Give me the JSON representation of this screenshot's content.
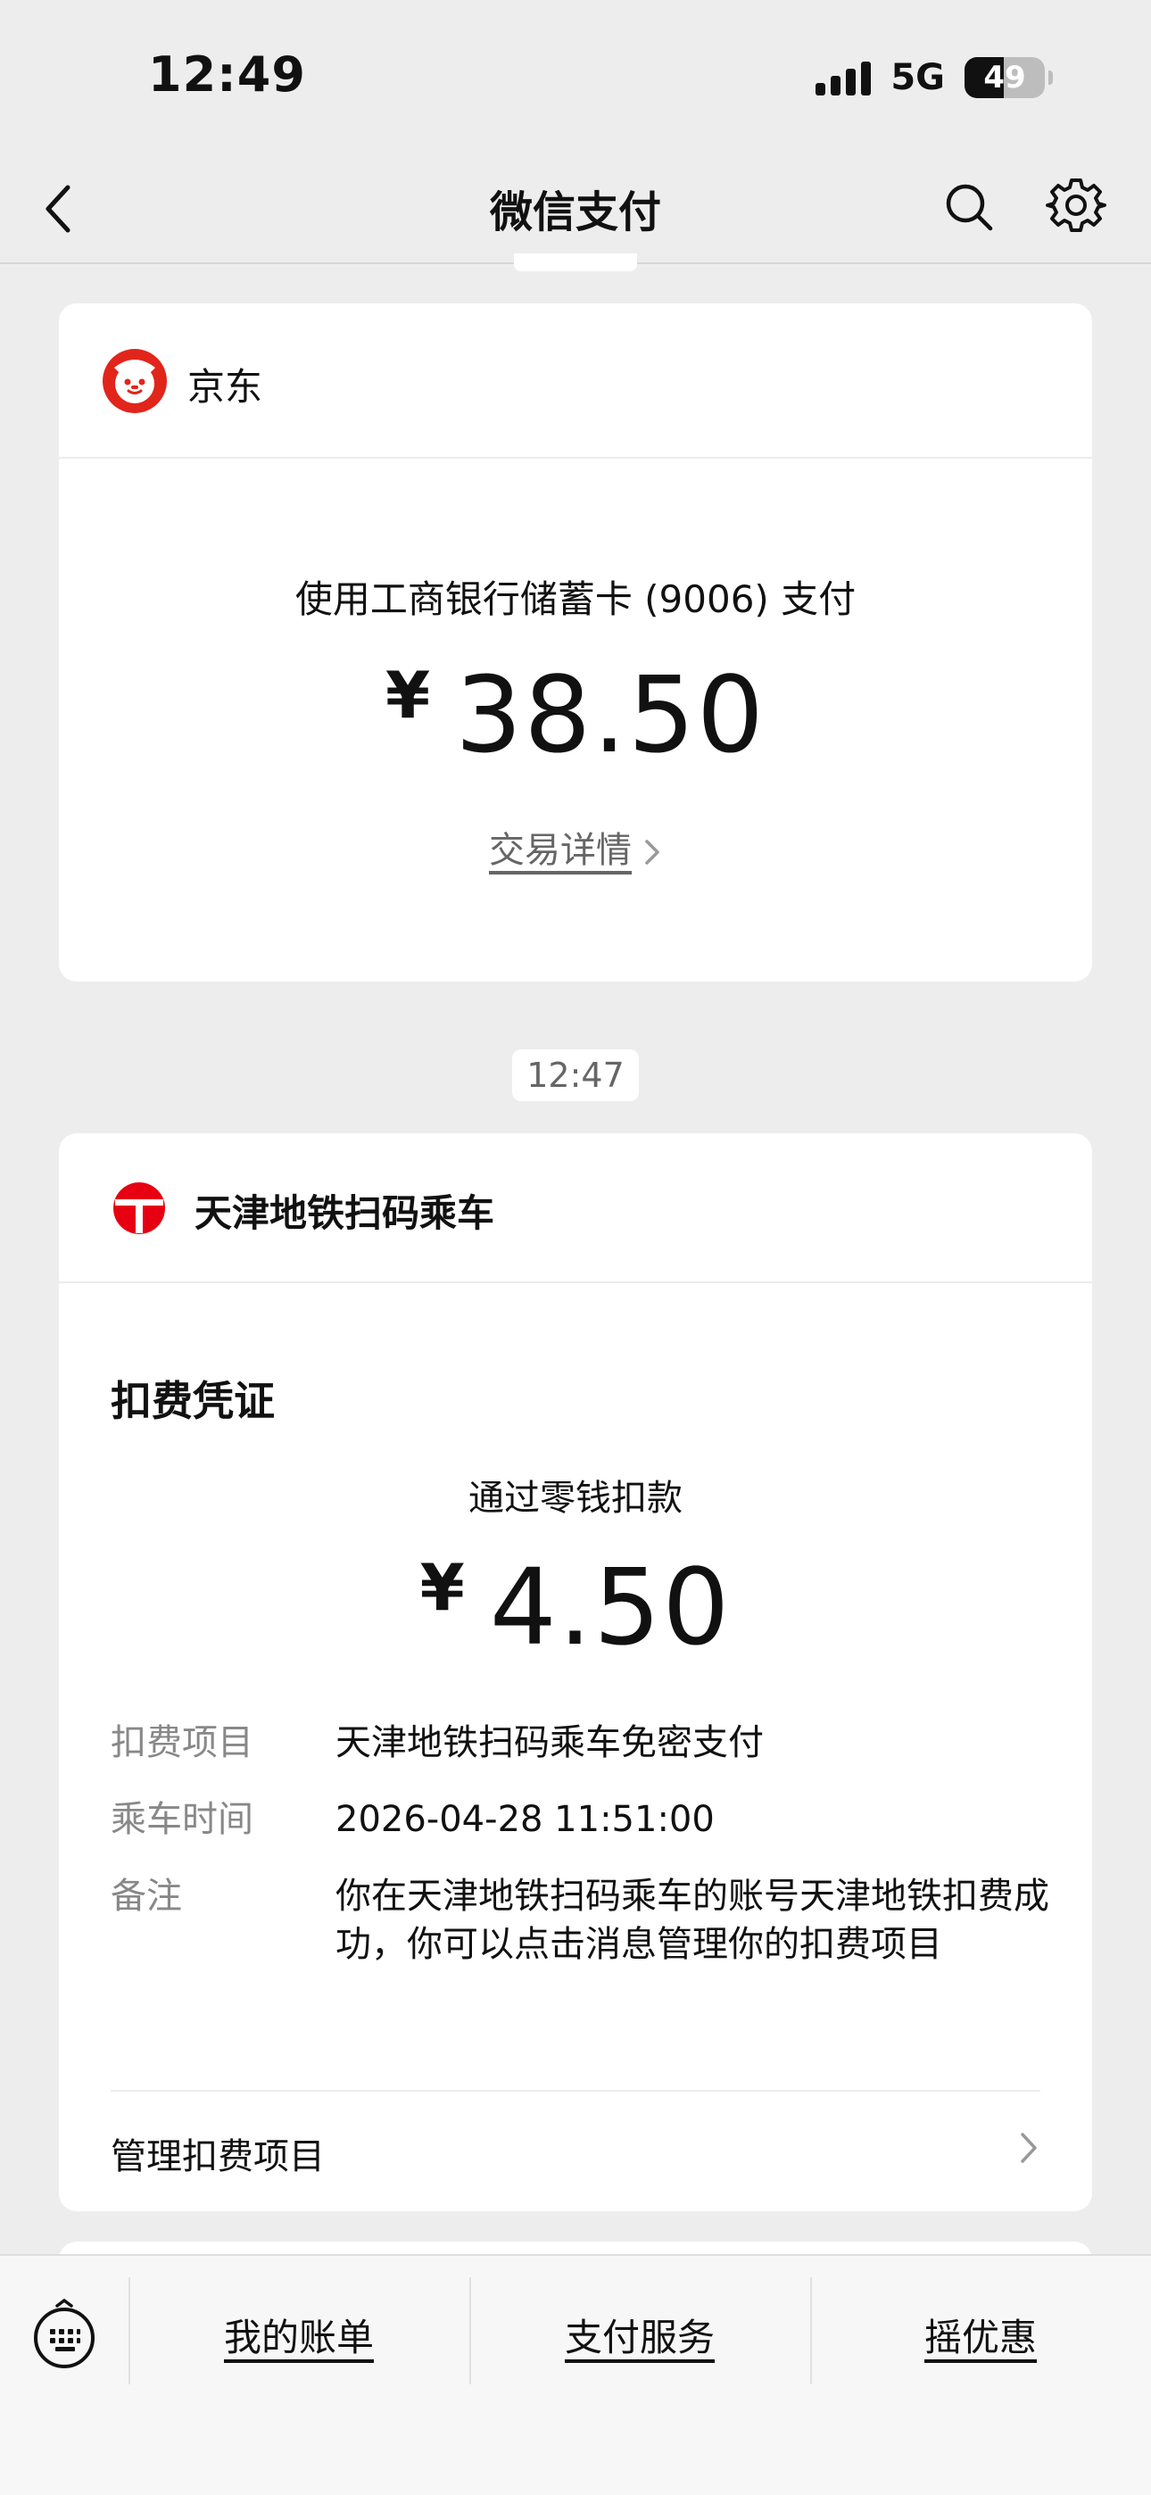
{
  "status": {
    "time": "12:49",
    "network": "5G",
    "battery": "49",
    "battery_level": 0.49
  },
  "nav": {
    "title": "微信支付"
  },
  "card1": {
    "merchant": "京东",
    "pay_method": "使用工商银行储蓄卡 (9006) 支付",
    "currency": "¥",
    "amount": "38.50",
    "detail_link": "交易详情"
  },
  "timestamp": "12:47",
  "card2": {
    "merchant": "天津地铁扫码乘车",
    "voucher_title": "扣费凭证",
    "via": "通过零钱扣款",
    "currency": "¥",
    "amount": "4.50",
    "rows": [
      {
        "label": "扣费项目",
        "value": "天津地铁扫码乘车免密支付"
      },
      {
        "label": "乘车时间",
        "value": "2026-04-28 11:51:00"
      },
      {
        "label": "备注",
        "value": "你在天津地铁扫码乘车的账号天津地铁扣费成功，你可以点击消息管理你的扣费项目"
      }
    ],
    "manage_label": "管理扣费项目"
  },
  "bottom_menu": [
    "我的账单",
    "支付服务",
    "摇优惠"
  ],
  "colors": {
    "jd_red": "#e1251b",
    "metro_red": "#e60012",
    "background": "#ededed"
  }
}
